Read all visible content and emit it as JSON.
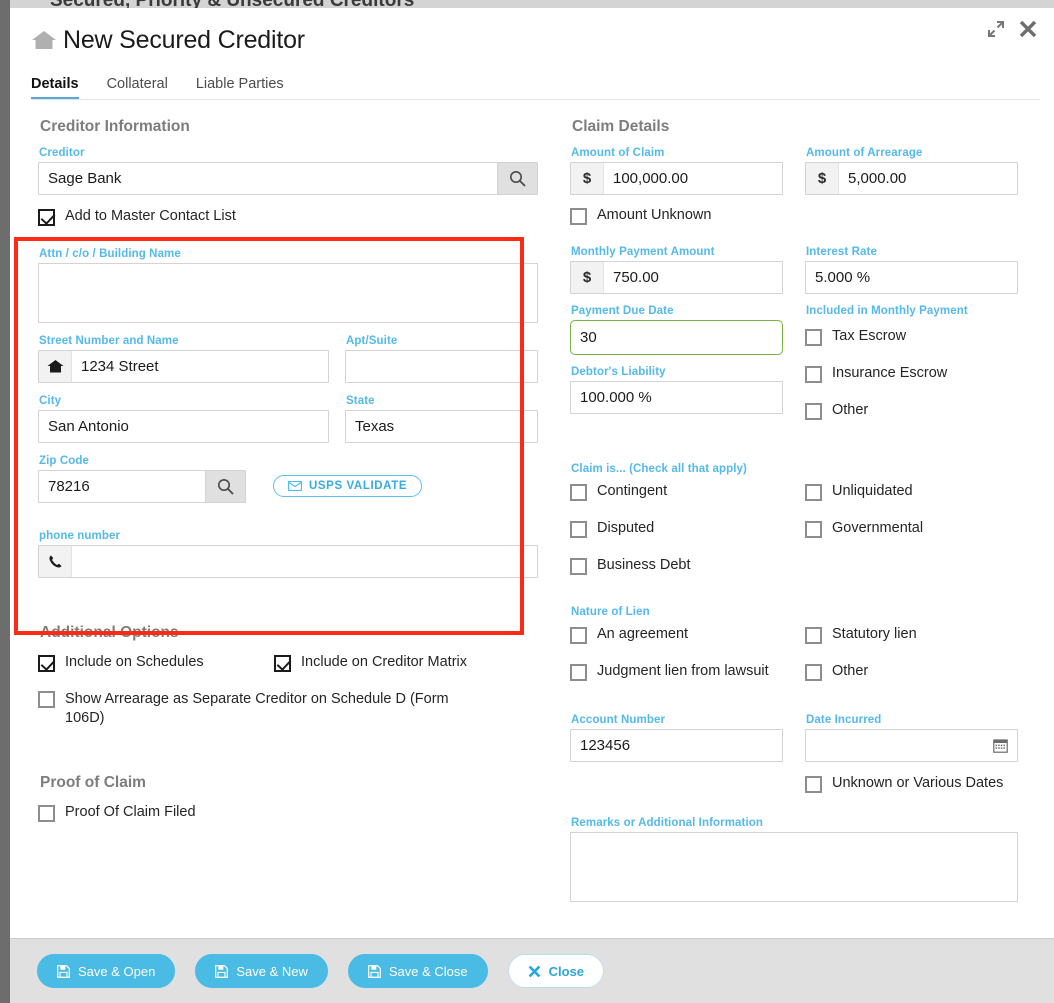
{
  "background": {
    "page_title": "Secured, Priority & Unsecured Creditors"
  },
  "window": {
    "title": "New Secured Creditor",
    "home_icon": "home-icon",
    "expand_icon": "expand-arrows-icon",
    "close_icon": "close-x-icon"
  },
  "tabs": [
    {
      "label": "Details",
      "active": true
    },
    {
      "label": "Collateral",
      "active": false
    },
    {
      "label": "Liable Parties",
      "active": false
    }
  ],
  "creditor_information": {
    "section_title": "Creditor Information",
    "creditor": {
      "label": "Creditor",
      "value": "Sage Bank",
      "search_icon": "search-icon"
    },
    "add_to_master": {
      "label": "Add to Master Contact List",
      "checked": true
    },
    "attn": {
      "label": "Attn / c/o / Building Name",
      "value": ""
    },
    "street": {
      "label": "Street Number and Name",
      "value": "1234 Street",
      "icon": "home-icon"
    },
    "apt": {
      "label": "Apt/Suite",
      "value": ""
    },
    "city": {
      "label": "City",
      "value": "San Antonio"
    },
    "state": {
      "label": "State",
      "value": "Texas"
    },
    "zip": {
      "label": "Zip Code",
      "value": "78216",
      "search_icon": "search-icon"
    },
    "usps": {
      "label": "USPS VALIDATE",
      "icon": "mail-icon"
    },
    "phone": {
      "label": "phone number",
      "value": "",
      "icon": "phone-icon"
    }
  },
  "additional_options": {
    "section_title": "Additional Options",
    "items": [
      {
        "label": "Include on Schedules",
        "checked": true
      },
      {
        "label": "Include on Creditor Matrix",
        "checked": true
      },
      {
        "label": "Show Arrearage as Separate Creditor on Schedule D (Form 106D)",
        "checked": false
      }
    ]
  },
  "proof_of_claim": {
    "section_title": "Proof of Claim",
    "items": [
      {
        "label": "Proof Of Claim Filed",
        "checked": false
      }
    ]
  },
  "claim_details": {
    "section_title": "Claim Details",
    "amount_of_claim": {
      "label": "Amount of Claim",
      "prefix": "$",
      "value": "100,000.00"
    },
    "amount_of_arrearage": {
      "label": "Amount of Arrearage",
      "prefix": "$",
      "value": "5,000.00"
    },
    "amount_unknown": {
      "label": "Amount Unknown",
      "checked": false
    },
    "monthly_payment": {
      "label": "Monthly Payment Amount",
      "prefix": "$",
      "value": "750.00"
    },
    "interest_rate": {
      "label": "Interest Rate",
      "value": "5.000 %"
    },
    "payment_due_date": {
      "label": "Payment Due Date",
      "value": "30",
      "highlighted": true
    },
    "debtors_liability": {
      "label": "Debtor's Liability",
      "value": "100.000 %"
    },
    "included_in_monthly_payment": {
      "label": "Included in Monthly Payment",
      "items": [
        {
          "label": "Tax Escrow",
          "checked": false
        },
        {
          "label": "Insurance Escrow",
          "checked": false
        },
        {
          "label": "Other",
          "checked": false
        }
      ]
    },
    "claim_is": {
      "label": "Claim is... (Check all that apply)",
      "left": [
        {
          "label": "Contingent",
          "checked": false
        },
        {
          "label": "Disputed",
          "checked": false
        },
        {
          "label": "Business Debt",
          "checked": false
        }
      ],
      "right": [
        {
          "label": "Unliquidated",
          "checked": false
        },
        {
          "label": "Governmental",
          "checked": false
        }
      ]
    },
    "nature_of_lien": {
      "label": "Nature of Lien",
      "left": [
        {
          "label": "An agreement",
          "checked": false
        },
        {
          "label": "Judgment lien from lawsuit",
          "checked": false
        }
      ],
      "right": [
        {
          "label": "Statutory lien",
          "checked": false
        },
        {
          "label": "Other",
          "checked": false
        }
      ]
    },
    "account_number": {
      "label": "Account Number",
      "value": "123456"
    },
    "date_incurred": {
      "label": "Date Incurred",
      "value": "",
      "icon": "calendar-icon"
    },
    "unknown_dates": {
      "label": "Unknown or Various Dates",
      "checked": false
    },
    "remarks": {
      "label": "Remarks or Additional Information",
      "value": ""
    }
  },
  "footer": {
    "buttons": [
      {
        "label": "Save & Open",
        "icon": "save-icon",
        "style": "primary"
      },
      {
        "label": "Save & New",
        "icon": "save-icon",
        "style": "primary"
      },
      {
        "label": "Save & Close",
        "icon": "save-icon",
        "style": "primary"
      },
      {
        "label": "Close",
        "icon": "close-x-icon",
        "style": "ghost"
      }
    ]
  },
  "colors": {
    "accent_blue": "#49bbe4",
    "label_blue": "#54b9ec",
    "highlight_red": "#fc2a16",
    "focus_green": "#7cb342"
  }
}
